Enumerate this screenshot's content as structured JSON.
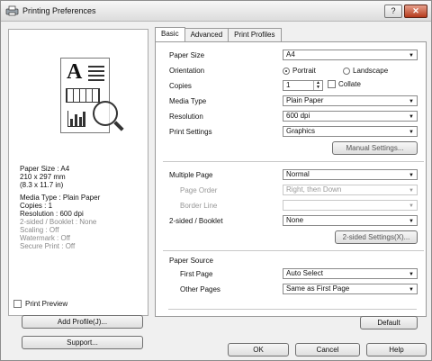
{
  "window": {
    "title": "Printing Preferences",
    "help_label": "?",
    "close_label": "✕"
  },
  "left": {
    "info": [
      {
        "text": "Paper Size : A4",
        "dim": false
      },
      {
        "text": "210 x 297 mm",
        "dim": false
      },
      {
        "text": "(8.3 x 11.7 in)",
        "dim": false
      },
      {
        "text": "",
        "gap": true
      },
      {
        "text": "Media Type : Plain Paper",
        "dim": false
      },
      {
        "text": "Copies : 1",
        "dim": false
      },
      {
        "text": "Resolution : 600 dpi",
        "dim": false
      },
      {
        "text": "2-sided / Booklet : None",
        "dim": true
      },
      {
        "text": "Scaling : Off",
        "dim": true
      },
      {
        "text": "Watermark : Off",
        "dim": true
      },
      {
        "text": "Secure Print : Off",
        "dim": true
      }
    ],
    "print_preview_label": "Print Preview",
    "add_profile_label": "Add Profile(J)...",
    "support_label": "Support..."
  },
  "tabs": [
    {
      "label": "Basic",
      "active": true
    },
    {
      "label": "Advanced",
      "active": false
    },
    {
      "label": "Print Profiles",
      "active": false
    }
  ],
  "basic": {
    "paper_size": {
      "label": "Paper Size",
      "value": "A4"
    },
    "orientation": {
      "label": "Orientation",
      "portrait": "Portrait",
      "landscape": "Landscape"
    },
    "copies": {
      "label": "Copies",
      "value": "1",
      "collate": "Collate"
    },
    "media_type": {
      "label": "Media Type",
      "value": "Plain Paper"
    },
    "resolution": {
      "label": "Resolution",
      "value": "600 dpi"
    },
    "print_settings": {
      "label": "Print Settings",
      "value": "Graphics",
      "manual_button": "Manual Settings..."
    },
    "multiple_page": {
      "label": "Multiple Page",
      "value": "Normal"
    },
    "page_order": {
      "label": "Page Order",
      "value": "Right, then Down"
    },
    "border_line": {
      "label": "Border Line",
      "value": ""
    },
    "two_sided": {
      "label": "2-sided / Booklet",
      "value": "None",
      "settings_button": "2-sided Settings(X)..."
    },
    "paper_source": {
      "label": "Paper Source"
    },
    "first_page": {
      "label": "First Page",
      "value": "Auto Select"
    },
    "other_pages": {
      "label": "Other Pages",
      "value": "Same as First Page"
    },
    "default_button": "Default"
  },
  "footer": {
    "ok": "OK",
    "cancel": "Cancel",
    "help": "Help"
  }
}
